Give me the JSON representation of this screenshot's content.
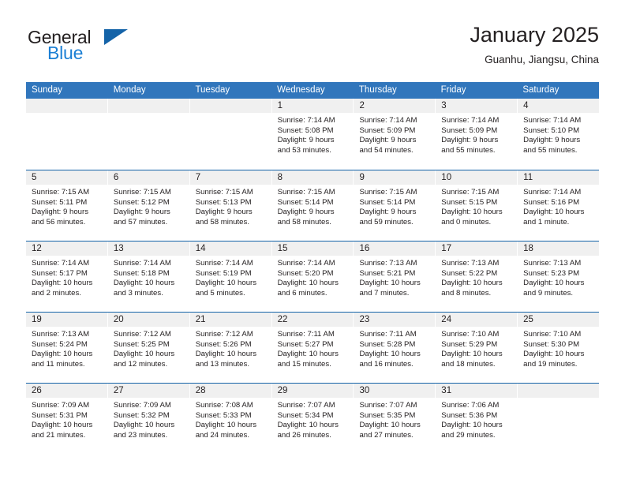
{
  "brand": {
    "word_one": "General",
    "word_two": "Blue",
    "triangle_icon": "triangle-icon"
  },
  "header": {
    "title": "January 2025",
    "location": "Guanhu, Jiangsu, China"
  },
  "colors": {
    "header_blue": "#3176bc",
    "rule_blue": "#1463a8",
    "band_gray": "#f0f0f0",
    "brand_blue": "#1b7fd4",
    "text": "#231f20"
  },
  "weekdays": [
    "Sunday",
    "Monday",
    "Tuesday",
    "Wednesday",
    "Thursday",
    "Friday",
    "Saturday"
  ],
  "weeks": [
    [
      {
        "day": "",
        "lines": []
      },
      {
        "day": "",
        "lines": []
      },
      {
        "day": "",
        "lines": []
      },
      {
        "day": "1",
        "lines": [
          "Sunrise: 7:14 AM",
          "Sunset: 5:08 PM",
          "Daylight: 9 hours",
          "and 53 minutes."
        ]
      },
      {
        "day": "2",
        "lines": [
          "Sunrise: 7:14 AM",
          "Sunset: 5:09 PM",
          "Daylight: 9 hours",
          "and 54 minutes."
        ]
      },
      {
        "day": "3",
        "lines": [
          "Sunrise: 7:14 AM",
          "Sunset: 5:09 PM",
          "Daylight: 9 hours",
          "and 55 minutes."
        ]
      },
      {
        "day": "4",
        "lines": [
          "Sunrise: 7:14 AM",
          "Sunset: 5:10 PM",
          "Daylight: 9 hours",
          "and 55 minutes."
        ]
      }
    ],
    [
      {
        "day": "5",
        "lines": [
          "Sunrise: 7:15 AM",
          "Sunset: 5:11 PM",
          "Daylight: 9 hours",
          "and 56 minutes."
        ]
      },
      {
        "day": "6",
        "lines": [
          "Sunrise: 7:15 AM",
          "Sunset: 5:12 PM",
          "Daylight: 9 hours",
          "and 57 minutes."
        ]
      },
      {
        "day": "7",
        "lines": [
          "Sunrise: 7:15 AM",
          "Sunset: 5:13 PM",
          "Daylight: 9 hours",
          "and 58 minutes."
        ]
      },
      {
        "day": "8",
        "lines": [
          "Sunrise: 7:15 AM",
          "Sunset: 5:14 PM",
          "Daylight: 9 hours",
          "and 58 minutes."
        ]
      },
      {
        "day": "9",
        "lines": [
          "Sunrise: 7:15 AM",
          "Sunset: 5:14 PM",
          "Daylight: 9 hours",
          "and 59 minutes."
        ]
      },
      {
        "day": "10",
        "lines": [
          "Sunrise: 7:15 AM",
          "Sunset: 5:15 PM",
          "Daylight: 10 hours",
          "and 0 minutes."
        ]
      },
      {
        "day": "11",
        "lines": [
          "Sunrise: 7:14 AM",
          "Sunset: 5:16 PM",
          "Daylight: 10 hours",
          "and 1 minute."
        ]
      }
    ],
    [
      {
        "day": "12",
        "lines": [
          "Sunrise: 7:14 AM",
          "Sunset: 5:17 PM",
          "Daylight: 10 hours",
          "and 2 minutes."
        ]
      },
      {
        "day": "13",
        "lines": [
          "Sunrise: 7:14 AM",
          "Sunset: 5:18 PM",
          "Daylight: 10 hours",
          "and 3 minutes."
        ]
      },
      {
        "day": "14",
        "lines": [
          "Sunrise: 7:14 AM",
          "Sunset: 5:19 PM",
          "Daylight: 10 hours",
          "and 5 minutes."
        ]
      },
      {
        "day": "15",
        "lines": [
          "Sunrise: 7:14 AM",
          "Sunset: 5:20 PM",
          "Daylight: 10 hours",
          "and 6 minutes."
        ]
      },
      {
        "day": "16",
        "lines": [
          "Sunrise: 7:13 AM",
          "Sunset: 5:21 PM",
          "Daylight: 10 hours",
          "and 7 minutes."
        ]
      },
      {
        "day": "17",
        "lines": [
          "Sunrise: 7:13 AM",
          "Sunset: 5:22 PM",
          "Daylight: 10 hours",
          "and 8 minutes."
        ]
      },
      {
        "day": "18",
        "lines": [
          "Sunrise: 7:13 AM",
          "Sunset: 5:23 PM",
          "Daylight: 10 hours",
          "and 9 minutes."
        ]
      }
    ],
    [
      {
        "day": "19",
        "lines": [
          "Sunrise: 7:13 AM",
          "Sunset: 5:24 PM",
          "Daylight: 10 hours",
          "and 11 minutes."
        ]
      },
      {
        "day": "20",
        "lines": [
          "Sunrise: 7:12 AM",
          "Sunset: 5:25 PM",
          "Daylight: 10 hours",
          "and 12 minutes."
        ]
      },
      {
        "day": "21",
        "lines": [
          "Sunrise: 7:12 AM",
          "Sunset: 5:26 PM",
          "Daylight: 10 hours",
          "and 13 minutes."
        ]
      },
      {
        "day": "22",
        "lines": [
          "Sunrise: 7:11 AM",
          "Sunset: 5:27 PM",
          "Daylight: 10 hours",
          "and 15 minutes."
        ]
      },
      {
        "day": "23",
        "lines": [
          "Sunrise: 7:11 AM",
          "Sunset: 5:28 PM",
          "Daylight: 10 hours",
          "and 16 minutes."
        ]
      },
      {
        "day": "24",
        "lines": [
          "Sunrise: 7:10 AM",
          "Sunset: 5:29 PM",
          "Daylight: 10 hours",
          "and 18 minutes."
        ]
      },
      {
        "day": "25",
        "lines": [
          "Sunrise: 7:10 AM",
          "Sunset: 5:30 PM",
          "Daylight: 10 hours",
          "and 19 minutes."
        ]
      }
    ],
    [
      {
        "day": "26",
        "lines": [
          "Sunrise: 7:09 AM",
          "Sunset: 5:31 PM",
          "Daylight: 10 hours",
          "and 21 minutes."
        ]
      },
      {
        "day": "27",
        "lines": [
          "Sunrise: 7:09 AM",
          "Sunset: 5:32 PM",
          "Daylight: 10 hours",
          "and 23 minutes."
        ]
      },
      {
        "day": "28",
        "lines": [
          "Sunrise: 7:08 AM",
          "Sunset: 5:33 PM",
          "Daylight: 10 hours",
          "and 24 minutes."
        ]
      },
      {
        "day": "29",
        "lines": [
          "Sunrise: 7:07 AM",
          "Sunset: 5:34 PM",
          "Daylight: 10 hours",
          "and 26 minutes."
        ]
      },
      {
        "day": "30",
        "lines": [
          "Sunrise: 7:07 AM",
          "Sunset: 5:35 PM",
          "Daylight: 10 hours",
          "and 27 minutes."
        ]
      },
      {
        "day": "31",
        "lines": [
          "Sunrise: 7:06 AM",
          "Sunset: 5:36 PM",
          "Daylight: 10 hours",
          "and 29 minutes."
        ]
      },
      {
        "day": "",
        "lines": []
      }
    ]
  ]
}
